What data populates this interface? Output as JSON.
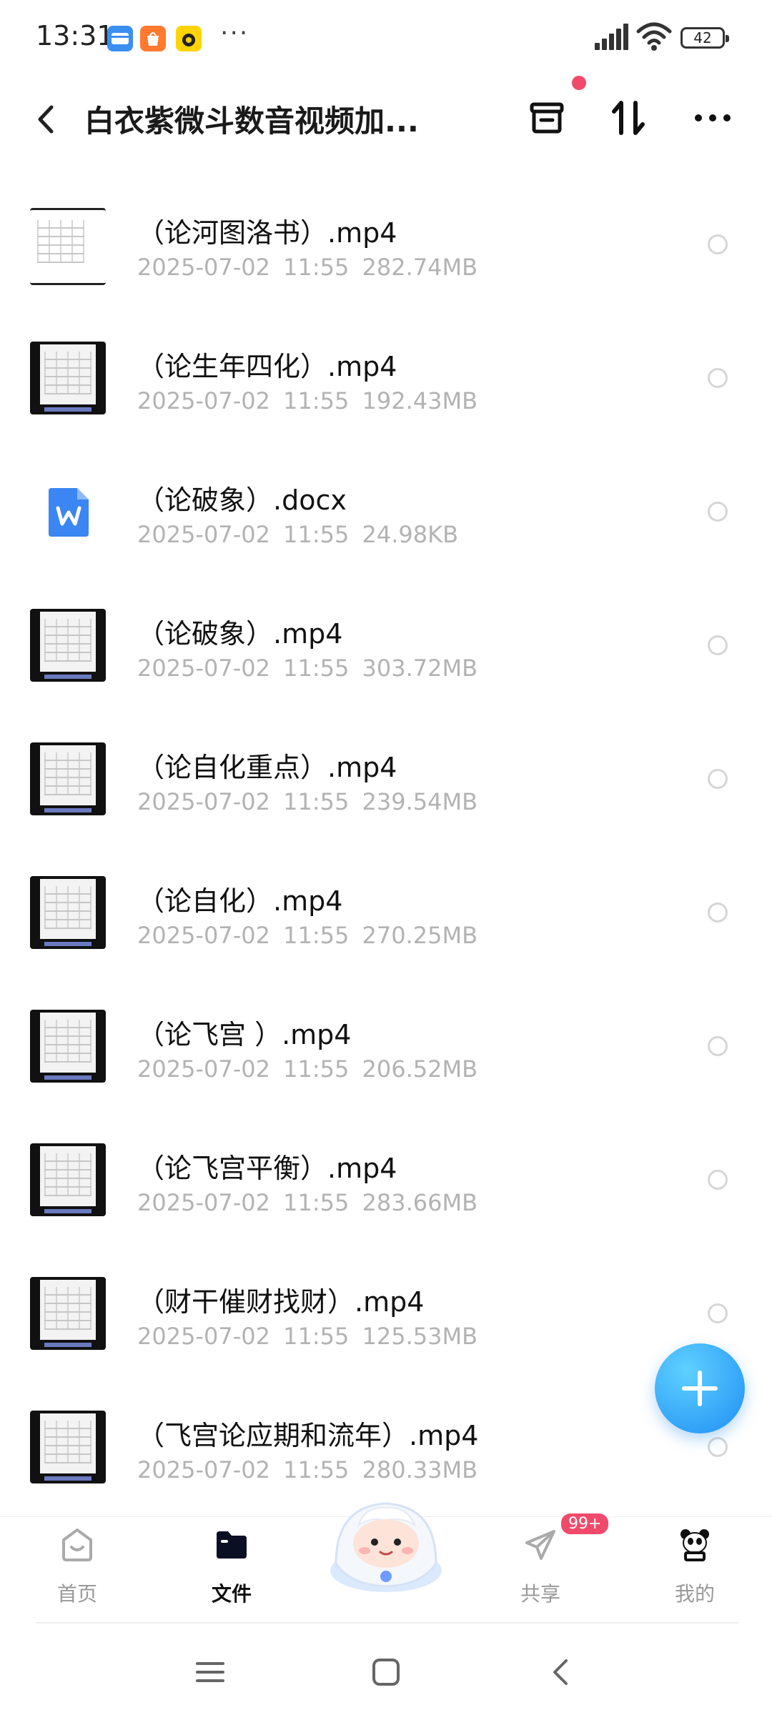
{
  "status_bar": {
    "time": "13:31",
    "battery": "42",
    "more": "···"
  },
  "header": {
    "title": "白衣紫微斗数音视频加..."
  },
  "files": [
    {
      "name": "（论河图洛书）.mp4",
      "date": "2025-07-02",
      "time": "11:55",
      "size": "282.74MB",
      "type": "video-light"
    },
    {
      "name": "（论生年四化）.mp4",
      "date": "2025-07-02",
      "time": "11:55",
      "size": "192.43MB",
      "type": "video"
    },
    {
      "name": "（论破象）.docx",
      "date": "2025-07-02",
      "time": "11:55",
      "size": "24.98KB",
      "type": "doc"
    },
    {
      "name": "（论破象）.mp4",
      "date": "2025-07-02",
      "time": "11:55",
      "size": "303.72MB",
      "type": "video"
    },
    {
      "name": "（论自化重点）.mp4",
      "date": "2025-07-02",
      "time": "11:55",
      "size": "239.54MB",
      "type": "video"
    },
    {
      "name": "（论自化）.mp4",
      "date": "2025-07-02",
      "time": "11:55",
      "size": "270.25MB",
      "type": "video"
    },
    {
      "name": "（论飞宫 ）.mp4",
      "date": "2025-07-02",
      "time": "11:55",
      "size": "206.52MB",
      "type": "video"
    },
    {
      "name": "（论飞宫平衡）.mp4",
      "date": "2025-07-02",
      "time": "11:55",
      "size": "283.66MB",
      "type": "video"
    },
    {
      "name": "（财干催财找财）.mp4",
      "date": "2025-07-02",
      "time": "11:55",
      "size": "125.53MB",
      "type": "video"
    },
    {
      "name": "（飞宫论应期和流年）.mp4",
      "date": "2025-07-02",
      "time": "11:55",
      "size": "280.33MB",
      "type": "video"
    }
  ],
  "nav": {
    "home": "首页",
    "files": "文件",
    "share": "共享",
    "share_badge": "99+",
    "me": "我的"
  },
  "colors": {
    "accent": "#1f8ef5",
    "badge": "#f04a6a",
    "meta_text": "#b3b3b3"
  }
}
